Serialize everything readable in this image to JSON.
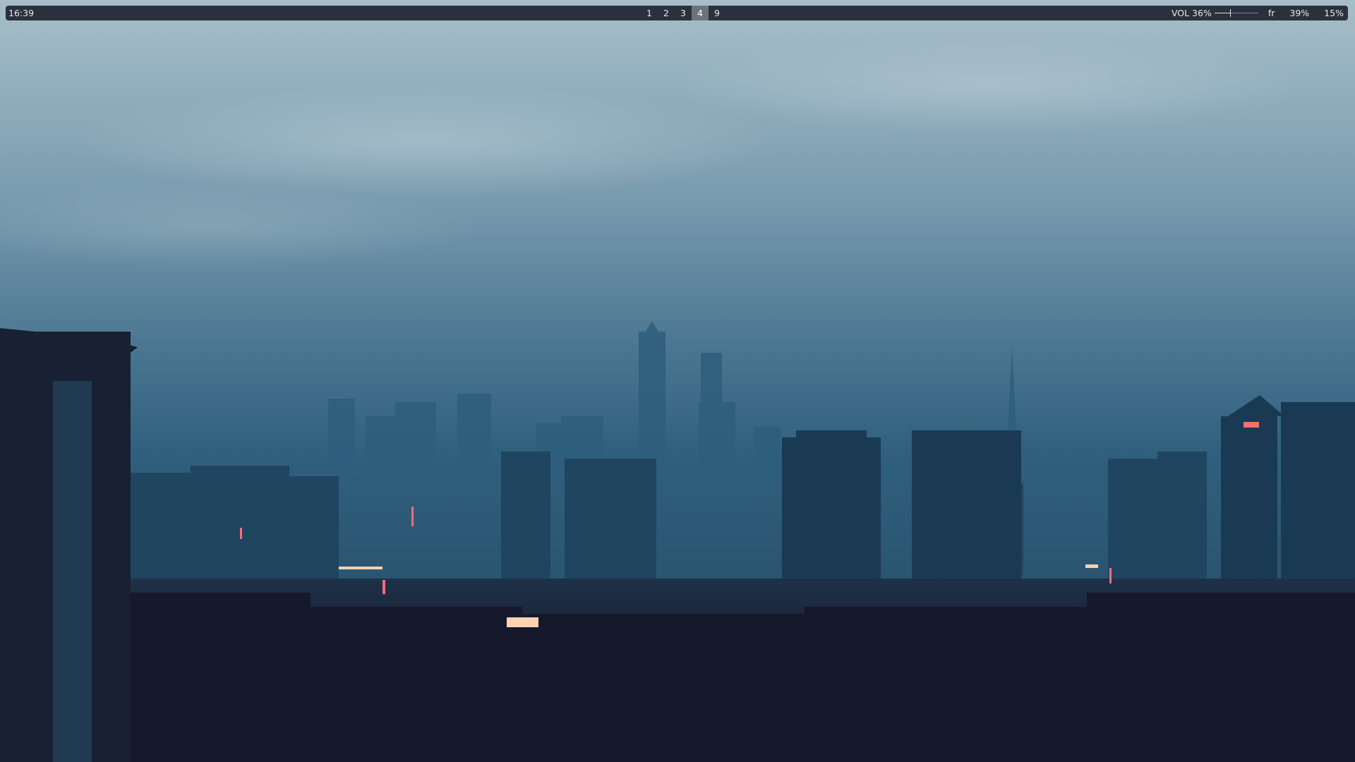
{
  "topbar": {
    "clock": "16:39",
    "workspaces": [
      {
        "label": "1",
        "active": false
      },
      {
        "label": "2",
        "active": false
      },
      {
        "label": "3",
        "active": false
      },
      {
        "label": "4",
        "active": true
      },
      {
        "label": "9",
        "active": false
      }
    ],
    "volume": {
      "label": "VOL 36%",
      "level_percent": 36
    },
    "keyboard_layout": "fr",
    "indicator_1": "39%",
    "indicator_2": "15%"
  },
  "colors": {
    "bar_background": "#2b313c",
    "bar_text": "#e6e8ec",
    "active_workspace": "#6b737f"
  }
}
